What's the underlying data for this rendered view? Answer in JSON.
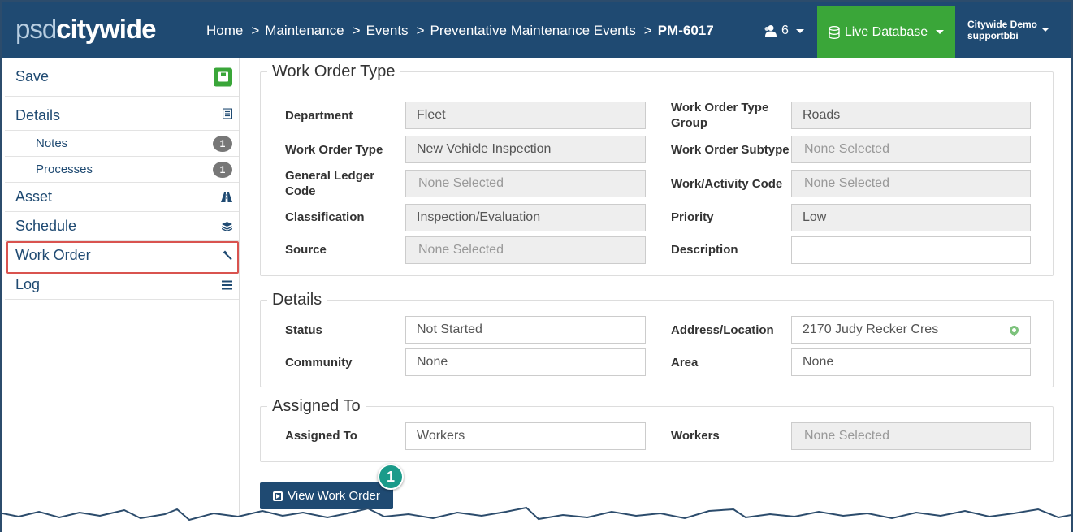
{
  "brand": {
    "logo_part1": "psd",
    "logo_part2": "citywide"
  },
  "breadcrumb": {
    "items": [
      "Home",
      "Maintenance",
      "Events",
      "Preventative Maintenance Events"
    ],
    "separator": ">",
    "current": "PM-6017"
  },
  "header": {
    "users_count": "6",
    "database_label": "Live Database",
    "account_name": "Citywide Demo",
    "account_user": "supportbbi"
  },
  "sidebar": {
    "save": "Save",
    "details": "Details",
    "notes": "Notes",
    "notes_count": "1",
    "processes": "Processes",
    "processes_count": "1",
    "asset": "Asset",
    "schedule": "Schedule",
    "work_order": "Work Order",
    "log": "Log"
  },
  "work_order_type": {
    "legend": "Work Order Type",
    "department_label": "Department",
    "department_value": "Fleet",
    "wot_group_label": "Work Order Type Group",
    "wot_group_value": "Roads",
    "wot_label": "Work Order Type",
    "wot_value": "New Vehicle Inspection",
    "subtype_label": "Work Order Subtype",
    "subtype_value": "None Selected",
    "gl_label": "General Ledger Code",
    "gl_value": "None Selected",
    "activity_label": "Work/Activity Code",
    "activity_value": "None Selected",
    "classification_label": "Classification",
    "classification_value": "Inspection/Evaluation",
    "priority_label": "Priority",
    "priority_value": "Low",
    "source_label": "Source",
    "source_value": "None Selected",
    "description_label": "Description",
    "description_value": ""
  },
  "details": {
    "legend": "Details",
    "status_label": "Status",
    "status_value": "Not Started",
    "address_label": "Address/Location",
    "address_value": "2170 Judy Recker Cres",
    "community_label": "Community",
    "community_value": "None",
    "area_label": "Area",
    "area_value": "None"
  },
  "assigned": {
    "legend": "Assigned To",
    "assigned_label": "Assigned To",
    "assigned_value": "Workers",
    "workers_label": "Workers",
    "workers_value": "None Selected"
  },
  "actions": {
    "view_work_order": "View Work Order",
    "callout_number": "1"
  },
  "colors": {
    "header_bg": "#1f4a72",
    "live_db_green": "#3aa639",
    "highlight_red": "#d9534f",
    "callout_teal": "#1b9b8a"
  }
}
